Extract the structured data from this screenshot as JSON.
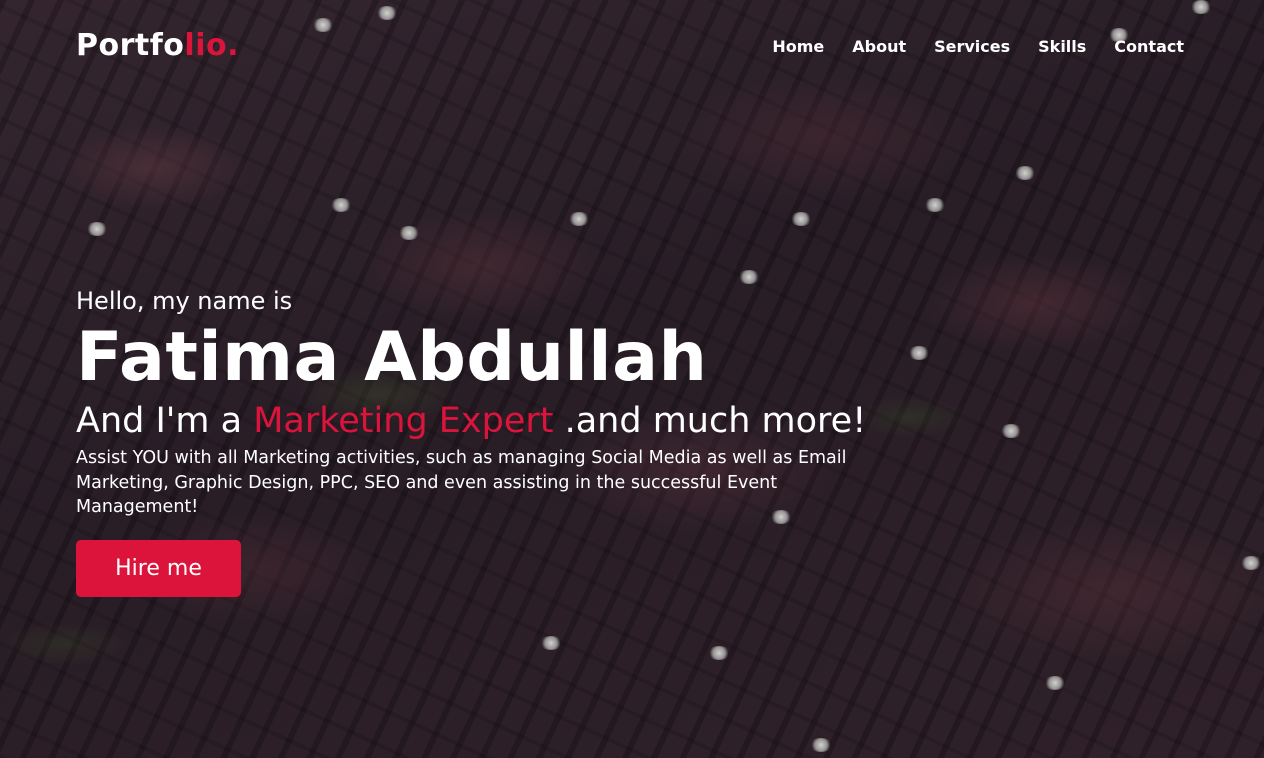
{
  "brand": {
    "logo_main": "Portfo",
    "logo_accent": "lio.",
    "accent_color": "#dc143c"
  },
  "nav": {
    "items": [
      {
        "label": "Home"
      },
      {
        "label": "About"
      },
      {
        "label": "Services"
      },
      {
        "label": "Skills"
      },
      {
        "label": "Contact"
      }
    ]
  },
  "hero": {
    "greeting": "Hello, my name is",
    "name": "Fatima Abdullah",
    "role_prefix": "And I'm a ",
    "role_highlight": "Marketing Expert",
    "role_suffix": " .and much more!",
    "description": "Assist YOU with all Marketing activities, such as managing Social Media as well as Email Marketing, Graphic Design, PPC, SEO and even assisting in the successful Event Management!",
    "cta_label": "Hire me"
  },
  "background": {
    "description_icon": "rocky-cliff-background-image"
  }
}
